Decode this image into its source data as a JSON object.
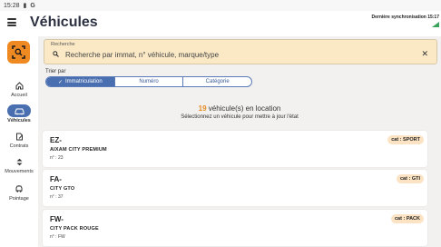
{
  "status_bar": {
    "time": "15:28",
    "icons": [
      "battery-icon",
      "google-icon"
    ]
  },
  "header": {
    "title": "Véhicules",
    "sync_label": "Dernière synchronisation 15:17",
    "sync_icon": "signal-icon",
    "menu_icon": "hamburger-icon"
  },
  "sidebar": {
    "scan_icon": "scan-icon",
    "items": [
      {
        "label": "Accueil",
        "icon": "home-icon",
        "active": false
      },
      {
        "label": "Véhicules",
        "icon": "car-icon",
        "active": true
      },
      {
        "label": "Contrats",
        "icon": "contract-icon",
        "active": false
      },
      {
        "label": "Mouvements",
        "icon": "movements-icon",
        "active": false
      },
      {
        "label": "Pointage",
        "icon": "pointage-icon",
        "active": false
      }
    ]
  },
  "search": {
    "label": "Recherche",
    "placeholder": "Recherche par immat, n° véhicule, marque/type",
    "value": ""
  },
  "sort": {
    "label": "Trier par",
    "options": [
      "Immatriculation",
      "Numéro",
      "Catégorie"
    ],
    "selected": "Immatriculation"
  },
  "summary": {
    "count": "19",
    "count_suffix": " véhicule(s) en location",
    "hint": "Sélectionnez un véhicule pour mettre à jour l'état"
  },
  "vehicles": [
    {
      "plate": "EZ-",
      "model": "AIXAM CITY PREMIUM",
      "number": "n° : 23",
      "category": "cat : SPORT"
    },
    {
      "plate": "FA-",
      "model": "CITY GTO",
      "number": "n° : 37",
      "category": "cat : GTI"
    },
    {
      "plate": "FW-",
      "model": "CITY PACK ROUGE",
      "number": "n° : FW",
      "category": "cat : PACK"
    }
  ],
  "colors": {
    "accent": "#ef8a22",
    "primary": "#4a6fb0",
    "search_bg": "#fbe9c6",
    "content_bg": "#f2f1ef",
    "badge_bg": "#fbe3c4"
  }
}
